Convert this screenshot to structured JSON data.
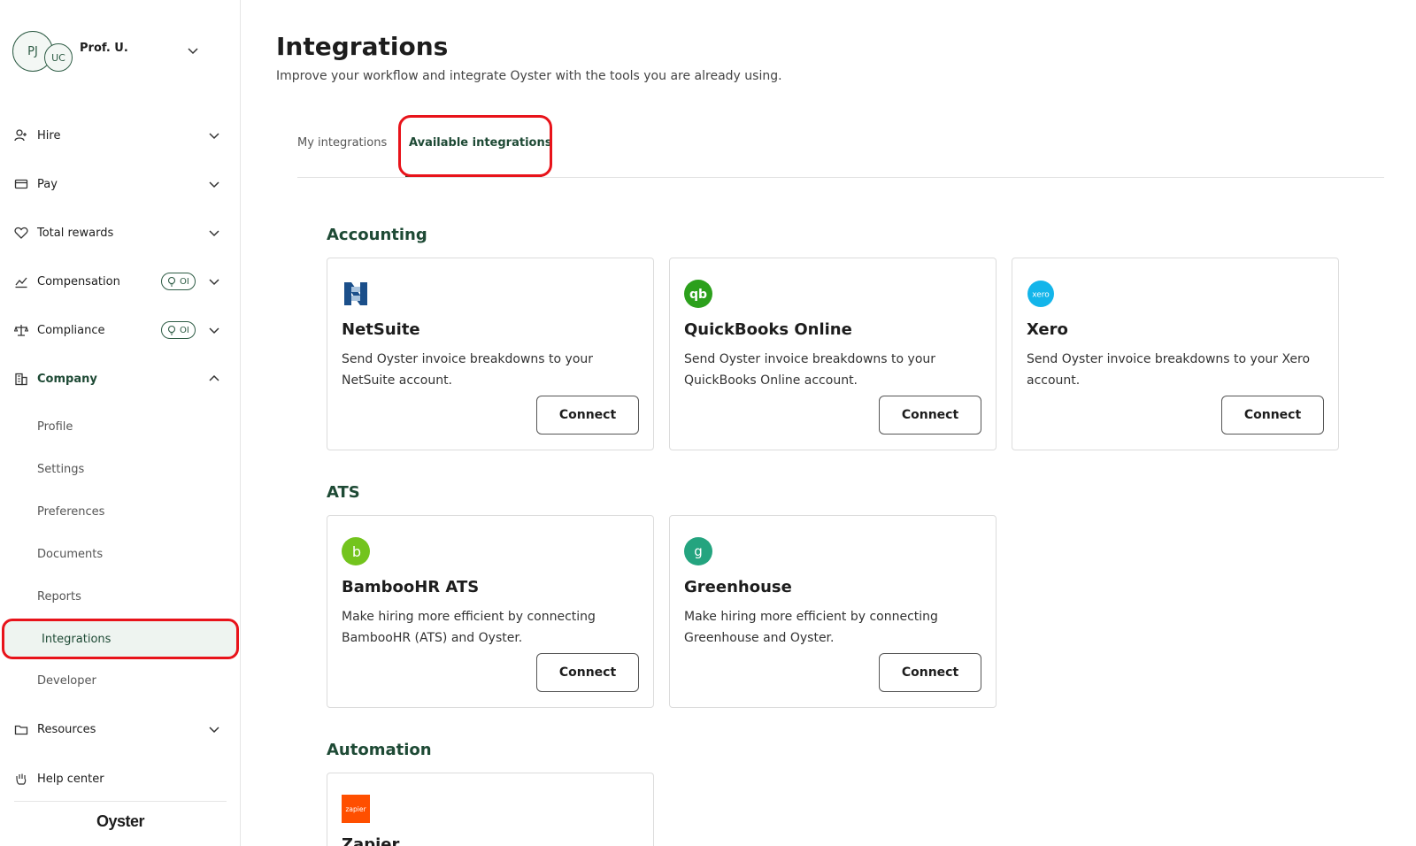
{
  "user": {
    "initials_main": "PJ",
    "initials_sub": "UC",
    "name": "Prof. U."
  },
  "sidebar": {
    "items": [
      {
        "label": "Hire",
        "icon": "user-plus-icon"
      },
      {
        "label": "Pay",
        "icon": "wallet-icon"
      },
      {
        "label": "Total rewards",
        "icon": "heart-icon"
      },
      {
        "label": "Compensation",
        "icon": "chart-icon",
        "badge": "OI"
      },
      {
        "label": "Compliance",
        "icon": "scale-icon",
        "badge": "OI"
      },
      {
        "label": "Company",
        "icon": "building-icon"
      }
    ],
    "company_sub": [
      "Profile",
      "Settings",
      "Preferences",
      "Documents",
      "Reports",
      "Integrations",
      "Developer"
    ],
    "bottom_items": [
      {
        "label": "Resources",
        "icon": "folder-icon"
      },
      {
        "label": "Help center",
        "icon": "hand-icon"
      }
    ],
    "brand": "Oyster"
  },
  "header": {
    "title": "Integrations",
    "subtitle": "Improve your workflow and integrate Oyster with the tools you are already using."
  },
  "tabs": [
    {
      "label": "My integrations"
    },
    {
      "label": "Available integrations"
    }
  ],
  "sections": {
    "accounting": "Accounting",
    "ats": "ATS",
    "automation": "Automation"
  },
  "cards": {
    "netsuite": {
      "name": "NetSuite",
      "desc": "Send Oyster invoice breakdowns to your NetSuite account.",
      "button": "Connect"
    },
    "quickbooks": {
      "name": "QuickBooks Online",
      "desc": "Send Oyster invoice breakdowns to your QuickBooks Online account.",
      "button": "Connect",
      "logo_text": "qb"
    },
    "xero": {
      "name": "Xero",
      "desc": "Send Oyster invoice breakdowns to your Xero account.",
      "button": "Connect",
      "logo_text": "xero"
    },
    "bamboohr": {
      "name": "BambooHR ATS",
      "desc": "Make hiring more efficient by connecting BambooHR (ATS) and Oyster.",
      "button": "Connect",
      "logo_text": "b"
    },
    "greenhouse": {
      "name": "Greenhouse",
      "desc": "Make hiring more efficient by connecting Greenhouse and Oyster.",
      "button": "Connect",
      "logo_text": "g"
    },
    "zapier": {
      "name": "Zapier",
      "logo_text": "zapier"
    }
  },
  "colors": {
    "accent": "#1e4a35",
    "highlight": "#e8131a",
    "quickbooks": "#2ca01c",
    "xero": "#13b5ea",
    "bamboohr": "#73c41d",
    "greenhouse": "#24a47f",
    "zapier": "#ff4f00"
  }
}
